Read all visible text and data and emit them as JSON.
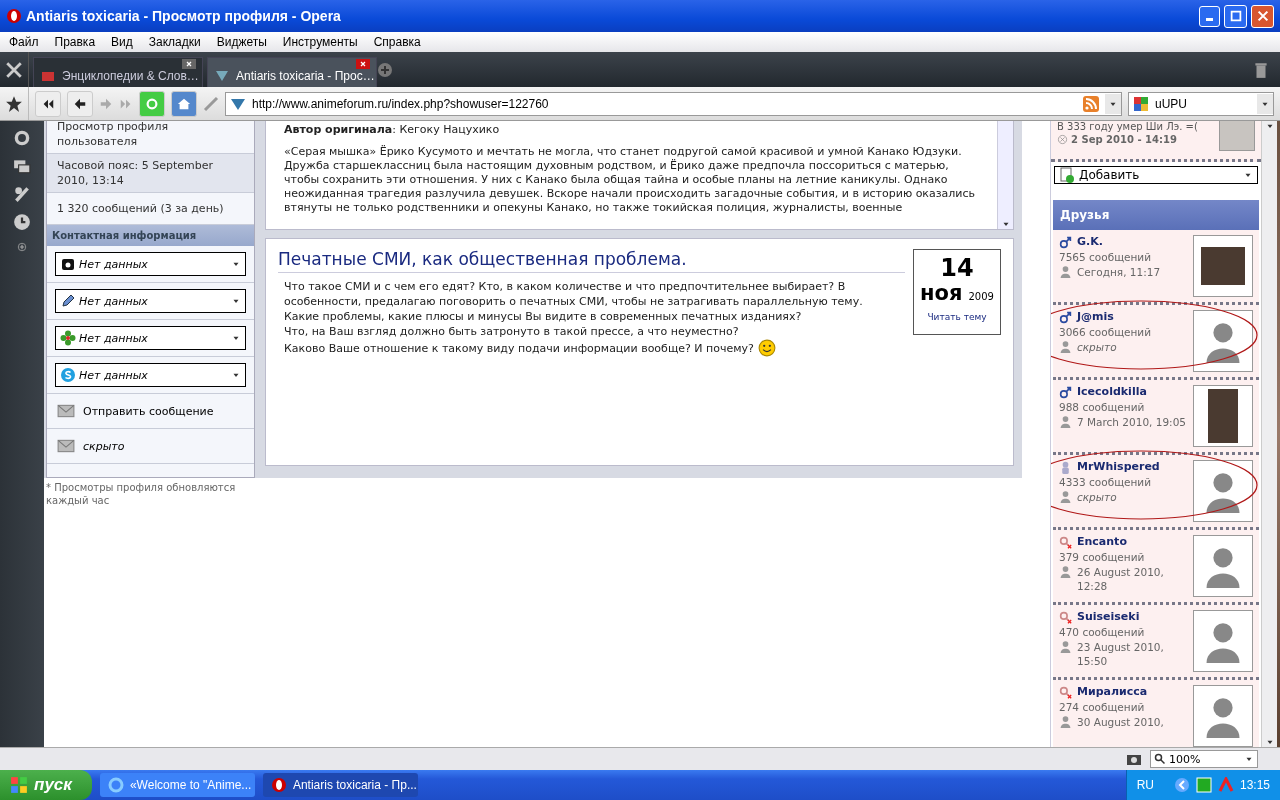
{
  "window": {
    "title": "Antiaris toxicaria - Просмотр профиля - Opera"
  },
  "menu": [
    "Файл",
    "Правка",
    "Вид",
    "Закладки",
    "Виджеты",
    "Инструменты",
    "Справка"
  ],
  "tabs": [
    {
      "label": "Энциклопедии & Слов…",
      "selected": false
    },
    {
      "label": "Antiaris toxicaria - Прос…",
      "selected": true
    }
  ],
  "address": {
    "url": "http://www.animeforum.ru/index.php?showuser=122760"
  },
  "search": {
    "value": "uUPU"
  },
  "profile_sidebar": {
    "view_label": "Просмотр профиля пользователя",
    "timezone": "Часовой пояс: 5 September 2010, 13:14",
    "posts": "1 320 сообщений (3 за день)",
    "contacts_header": "Контактная информация",
    "contacts": [
      {
        "kind": "phone",
        "value": "Нет данных"
      },
      {
        "kind": "pencil",
        "value": "Нет данных"
      },
      {
        "kind": "flower",
        "value": "Нет данных"
      },
      {
        "kind": "skype",
        "value": "Нет данных"
      }
    ],
    "actions": [
      {
        "label": "Отправить сообщение",
        "hidden": false
      },
      {
        "label": "скрыто",
        "hidden": true
      }
    ],
    "note": "* Просмотры профиля обновляются каждый час"
  },
  "about_box": {
    "author_line": "**Автор оригинала**: Кегоку Нацухико",
    "paragraph": "«Серая мышка» Ёрико Кусумото и мечтать не могла, что станет подругой самой красивой и умной Канако Юдзуки. Дружба старшеклассниц была настоящим духовным родством, и Ёрико даже предпочла поссориться с матерью, чтобы сохранить эти отношения. У них с Канако была общая тайна и особые планы на летние каникулы. Однако неожиданная трагедия разлучила девушек. Вскоре начали происходить загадочные события, и в историю оказались втянуты не только родственники и опекуны Канако, но также токийская полиция, журналисты, военные"
  },
  "topic": {
    "title": "Печатные СМИ, как общественная проблема.",
    "lines": [
      "Что такое СМИ и с чем его едят? Кто, в каком количестве и что предпочтительнее выбирает? В",
      "особенности, предалагаю поговорить о печатных СМИ, чтобы не затрагивать параллельную тему.",
      "Какие проблемы, какие плюсы и минусы Вы видите в современных печатных изданиях?",
      "Что, на Ваш взгляд должно быть затронуто в такой прессе, а что неуместно?",
      "Каково Ваше отношение к такому виду подачи информации вообще? И почему?"
    ],
    "date": {
      "day": "14",
      "month": "ноя",
      "year": "2009"
    },
    "link": "Читать тему"
  },
  "right_column": {
    "status": {
      "text": "В 333 году умер Ши Лэ. =(",
      "date": "2 Sep 2010 - 14:19"
    },
    "add_select": "Добавить",
    "friends_header": "Друзья",
    "friends": [
      {
        "kind": "male",
        "name": "G.K.",
        "posts": "7565 сообщений",
        "last_seen": "Сегодня, 11:17",
        "hidden": false,
        "has_photo": true,
        "circled": false
      },
      {
        "kind": "male",
        "name": "J@mis",
        "posts": "3066 сообщений",
        "last_seen": "скрыто",
        "hidden": true,
        "has_photo": false,
        "circled": true
      },
      {
        "kind": "male",
        "name": "Icecoldkilla",
        "posts": "988 сообщений",
        "last_seen": "7 March 2010, 19:05",
        "hidden": false,
        "has_photo": true,
        "circled": false
      },
      {
        "kind": "unknown",
        "name": "MrWhispered",
        "posts": "4333 сообщений",
        "last_seen": "скрыто",
        "hidden": true,
        "has_photo": false,
        "circled": true
      },
      {
        "kind": "female",
        "name": "Encanto",
        "posts": "379 сообщений",
        "last_seen": "26 August 2010, 12:28",
        "hidden": false,
        "has_photo": false,
        "circled": false
      },
      {
        "kind": "female",
        "name": "Suiseiseki",
        "posts": "470 сообщений",
        "last_seen": "23 August 2010, 15:50",
        "hidden": false,
        "has_photo": false,
        "circled": false
      },
      {
        "kind": "female",
        "name": "Миралисса",
        "posts": "274 сообщений",
        "last_seen": "30 August 2010,",
        "hidden": false,
        "has_photo": false,
        "circled": false
      }
    ]
  },
  "status_bar": {
    "zoom": "100%"
  },
  "taskbar": {
    "start": "пуск",
    "items": [
      {
        "label": "«Welcome to \"Anime...",
        "selected": false
      },
      {
        "label": "Antiaris toxicaria - Пр...",
        "selected": true
      }
    ],
    "language": "RU",
    "clock": "13:15"
  }
}
